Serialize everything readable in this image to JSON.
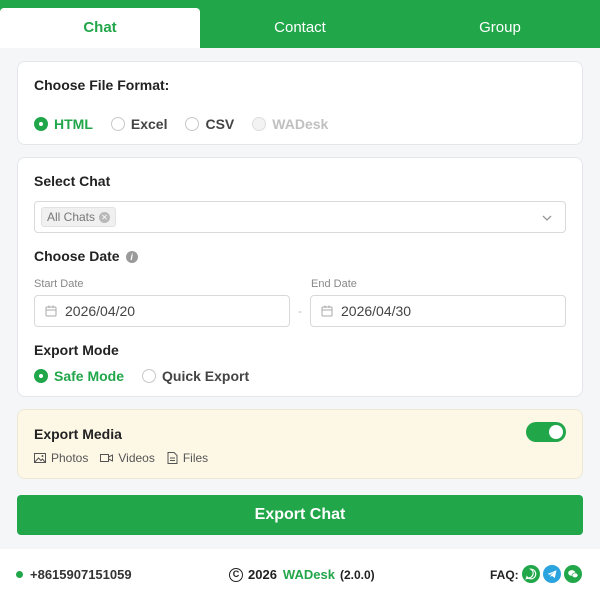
{
  "tabs": [
    {
      "label": "Chat",
      "active": true
    },
    {
      "label": "Contact",
      "active": false
    },
    {
      "label": "Group",
      "active": false
    }
  ],
  "file_format": {
    "title": "Choose File Format:",
    "options": [
      {
        "label": "HTML",
        "state": "checked"
      },
      {
        "label": "Excel",
        "state": "unchecked"
      },
      {
        "label": "CSV",
        "state": "unchecked"
      },
      {
        "label": "WADesk",
        "state": "disabled"
      }
    ]
  },
  "select_chat": {
    "title": "Select Chat",
    "tag": "All Chats"
  },
  "choose_date": {
    "title": "Choose Date",
    "start_label": "Start Date",
    "start_value": "2026/04/20",
    "separator": "-",
    "end_label": "End Date",
    "end_value": "2026/04/30"
  },
  "export_mode": {
    "title": "Export Mode",
    "options": [
      {
        "label": "Safe Mode",
        "state": "checked"
      },
      {
        "label": "Quick Export",
        "state": "unchecked"
      }
    ]
  },
  "export_media": {
    "title": "Export Media",
    "enabled": true,
    "items": [
      {
        "label": "Photos",
        "icon": "image-icon"
      },
      {
        "label": "Videos",
        "icon": "video-icon"
      },
      {
        "label": "Files",
        "icon": "file-icon"
      }
    ]
  },
  "export_button": "Export Chat",
  "footer": {
    "phone": "+8615907151059",
    "year": "2026",
    "brand": "WADesk",
    "version": "(2.0.0)",
    "faq": "FAQ:"
  },
  "colors": {
    "accent": "#21a64a",
    "telegram": "#2aa3df",
    "media_bg": "#fdf7e6"
  }
}
